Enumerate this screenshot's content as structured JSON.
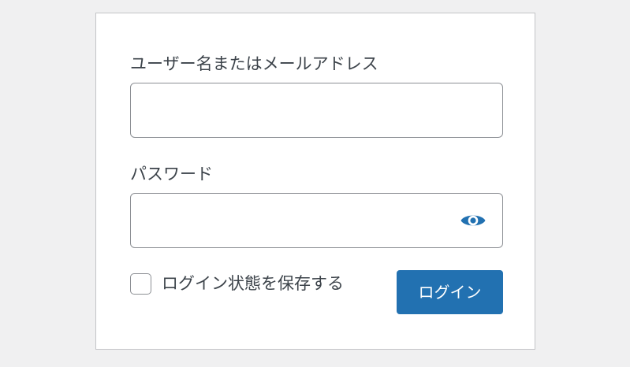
{
  "login_form": {
    "username_label": "ユーザー名またはメールアドレス",
    "username_value": "",
    "password_label": "パスワード",
    "password_value": "",
    "show_password_icon": "eye-icon",
    "remember_label": "ログイン状態を保存する",
    "remember_checked": false,
    "submit_label": "ログイン"
  },
  "colors": {
    "background": "#f0f0f1",
    "card": "#ffffff",
    "accent": "#2271b1",
    "text": "#3c434a",
    "border": "#8c8f94"
  }
}
